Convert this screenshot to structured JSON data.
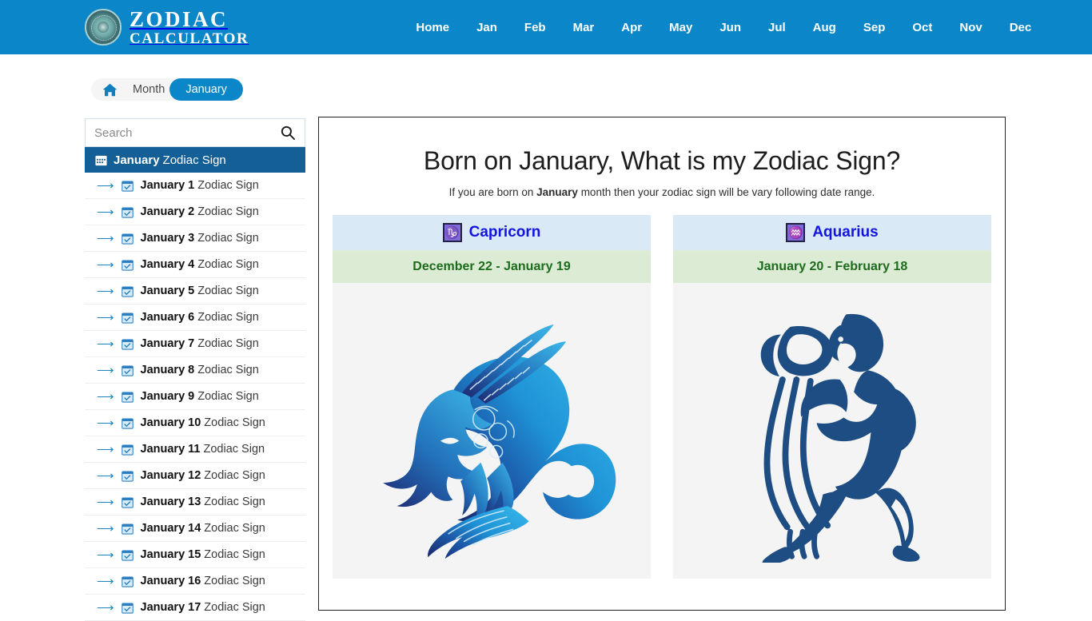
{
  "header": {
    "brand": {
      "line1": "ZODIAC",
      "line2": "CALCULATOR",
      "logo_icon": "zodiac-wheel-icon"
    },
    "nav": [
      {
        "label": "Home"
      },
      {
        "label": "Jan"
      },
      {
        "label": "Feb"
      },
      {
        "label": "Mar"
      },
      {
        "label": "Apr"
      },
      {
        "label": "May"
      },
      {
        "label": "Jun"
      },
      {
        "label": "Jul"
      },
      {
        "label": "Aug"
      },
      {
        "label": "Sep"
      },
      {
        "label": "Oct"
      },
      {
        "label": "Nov"
      },
      {
        "label": "Dec"
      }
    ],
    "background_color": "#0b86c8"
  },
  "breadcrumb": {
    "home_icon": "home-icon",
    "month_label": "Month",
    "current_label": "January",
    "active_color": "#0b86c8"
  },
  "sidebar": {
    "search": {
      "value": "",
      "placeholder": "Search",
      "icon": "search-icon"
    },
    "heading": {
      "bold": "January",
      "rest": "Zodiac Sign",
      "icon": "calendar-icon",
      "background_color": "#135f96"
    },
    "items": [
      {
        "bold": "January 1",
        "rest": "Zodiac Sign"
      },
      {
        "bold": "January 2",
        "rest": "Zodiac Sign"
      },
      {
        "bold": "January 3",
        "rest": "Zodiac Sign"
      },
      {
        "bold": "January 4",
        "rest": "Zodiac Sign"
      },
      {
        "bold": "January 5",
        "rest": "Zodiac Sign"
      },
      {
        "bold": "January 6",
        "rest": "Zodiac Sign"
      },
      {
        "bold": "January 7",
        "rest": "Zodiac Sign"
      },
      {
        "bold": "January 8",
        "rest": "Zodiac Sign"
      },
      {
        "bold": "January 9",
        "rest": "Zodiac Sign"
      },
      {
        "bold": "January 10",
        "rest": "Zodiac Sign"
      },
      {
        "bold": "January 11",
        "rest": "Zodiac Sign"
      },
      {
        "bold": "January 12",
        "rest": "Zodiac Sign"
      },
      {
        "bold": "January 13",
        "rest": "Zodiac Sign"
      },
      {
        "bold": "January 14",
        "rest": "Zodiac Sign"
      },
      {
        "bold": "January 15",
        "rest": "Zodiac Sign"
      },
      {
        "bold": "January 16",
        "rest": "Zodiac Sign"
      },
      {
        "bold": "January 17",
        "rest": "Zodiac Sign"
      }
    ]
  },
  "main": {
    "title": "Born on January, What is my Zodiac Sign?",
    "subtitle_before": "If you are born on ",
    "subtitle_bold": "January",
    "subtitle_after": " month then your zodiac sign will be vary following date range.",
    "cards": [
      {
        "name": "Capricorn",
        "glyph": "♑",
        "glyph_icon": "capricorn-glyph-icon",
        "date_range": "December 22 - January 19",
        "illustration": "capricorn-sea-goat-illustration",
        "name_color": "#1414e0",
        "range_color": "#1d6b1d",
        "head_background": "#d9eaf6",
        "range_background": "#dcecd4"
      },
      {
        "name": "Aquarius",
        "glyph": "♒",
        "glyph_icon": "aquarius-glyph-icon",
        "date_range": "January 20 - February 18",
        "illustration": "aquarius-water-bearer-illustration",
        "name_color": "#1414e0",
        "range_color": "#1d6b1d",
        "head_background": "#d9eaf6",
        "range_background": "#dcecd4"
      }
    ]
  }
}
